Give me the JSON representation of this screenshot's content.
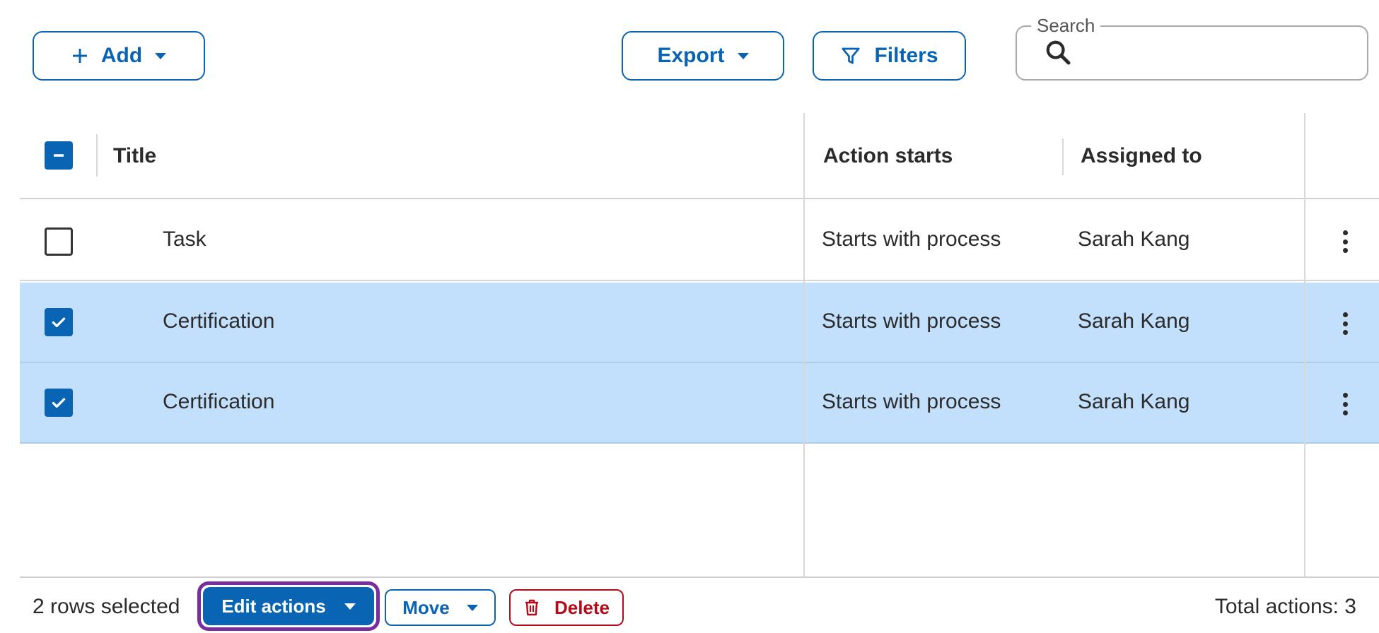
{
  "toolbar": {
    "add_label": "Add",
    "export_label": "Export",
    "filters_label": "Filters",
    "search_legend": "Search",
    "search_value": ""
  },
  "table": {
    "columns": [
      "Title",
      "Action starts",
      "Assigned to"
    ],
    "rows": [
      {
        "title": "Task",
        "action_starts": "Starts with process",
        "assigned_to": "Sarah Kang",
        "selected": false
      },
      {
        "title": "Certification",
        "action_starts": "Starts with process",
        "assigned_to": "Sarah Kang",
        "selected": true
      },
      {
        "title": "Certification",
        "action_starts": "Starts with process",
        "assigned_to": "Sarah Kang",
        "selected": true
      }
    ]
  },
  "footer": {
    "selection_text": "2 rows selected",
    "edit_actions_label": "Edit actions",
    "move_label": "Move",
    "delete_label": "Delete",
    "total_text": "Total actions: 3"
  },
  "colors": {
    "primary": "#0a64b4",
    "selected_row": "#c2e0fb",
    "danger": "#b40a1a",
    "focus_ring": "#7a2d9c"
  }
}
